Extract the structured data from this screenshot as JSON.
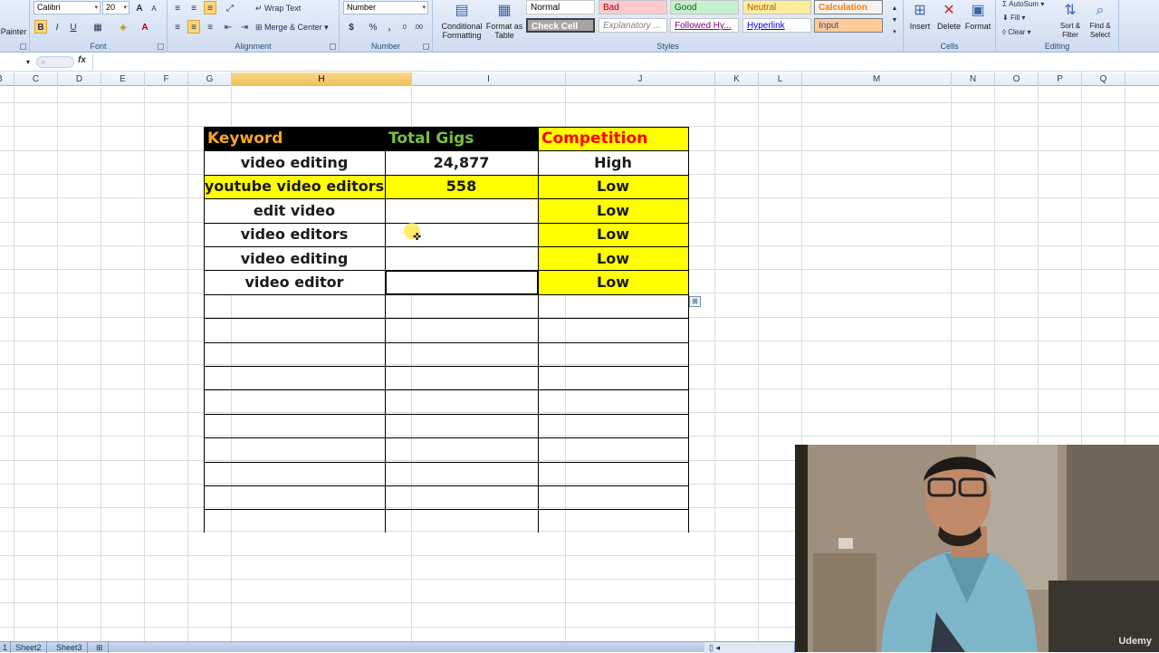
{
  "ribbon": {
    "clipboard": {
      "painter_label": "Painter"
    },
    "font": {
      "family": "Calibri",
      "size": "20",
      "bold": "B",
      "italic": "I",
      "underline": "U",
      "grow": "A",
      "shrink": "A",
      "group_label": "Font"
    },
    "alignment": {
      "wrap_text": "Wrap Text",
      "merge_center": "Merge & Center",
      "group_label": "Alignment"
    },
    "number": {
      "format": "Number",
      "currency": "$",
      "percent": "%",
      "comma": ",",
      "group_label": "Number"
    },
    "styles": {
      "conditional_formatting": "Conditional Formatting",
      "format_as_table": "Format as Table",
      "items": [
        {
          "label": "Normal",
          "bg": "#ffffff",
          "fg": "#000000"
        },
        {
          "label": "Bad",
          "bg": "#ffc7ce",
          "fg": "#9c0006"
        },
        {
          "label": "Good",
          "bg": "#c6efce",
          "fg": "#006100"
        },
        {
          "label": "Neutral",
          "bg": "#ffeb9c",
          "fg": "#9c6500"
        },
        {
          "label": "Calculation",
          "bg": "#f2f2f2",
          "fg": "#fa7d00"
        },
        {
          "label": "Check Cell",
          "bg": "#a5a5a5",
          "fg": "#ffffff"
        },
        {
          "label": "Explanatory ...",
          "bg": "#ffffff",
          "fg": "#7f7f7f"
        },
        {
          "label": "Followed Hy...",
          "bg": "#ffffff",
          "fg": "#800080"
        },
        {
          "label": "Hyperlink",
          "bg": "#ffffff",
          "fg": "#0000ff"
        },
        {
          "label": "Input",
          "bg": "#ffcc99",
          "fg": "#3f3f76"
        }
      ],
      "group_label": "Styles"
    },
    "cells": {
      "insert": "Insert",
      "delete": "Delete",
      "format": "Format",
      "group_label": "Cells"
    },
    "editing": {
      "autosum": "AutoSum",
      "fill": "Fill",
      "clear": "Clear",
      "sort_filter": "Sort & Filter",
      "find_select": "Find & Select",
      "group_label": "Editing"
    }
  },
  "formula_bar": {
    "search_placeholder": "",
    "fx": "fx",
    "value": ""
  },
  "columns": [
    {
      "label": "B"
    },
    {
      "label": "C"
    },
    {
      "label": "D"
    },
    {
      "label": "E"
    },
    {
      "label": "F"
    },
    {
      "label": "G"
    },
    {
      "label": "H",
      "selected": true
    },
    {
      "label": "I"
    },
    {
      "label": "J"
    },
    {
      "label": "K"
    },
    {
      "label": "L"
    },
    {
      "label": "M"
    },
    {
      "label": "N"
    },
    {
      "label": "O"
    },
    {
      "label": "P"
    },
    {
      "label": "Q"
    }
  ],
  "table": {
    "headers": [
      {
        "text": "Keyword",
        "color": "#f5a623",
        "bg": "#000000"
      },
      {
        "text": "Total Gigs",
        "color": "#7cbf3b",
        "bg": "#000000"
      },
      {
        "text": "Competition",
        "color": "#ff0000",
        "bg": "#ffff00"
      }
    ],
    "rows": [
      {
        "keyword": "video editing",
        "gigs": "24,877",
        "competition": "High",
        "keyword_bg": "#ffffff",
        "gigs_bg": "#ffffff",
        "comp_bg": "#ffffff"
      },
      {
        "keyword": "youtube video editors",
        "gigs": "558",
        "competition": "Low",
        "keyword_bg": "#ffff00",
        "gigs_bg": "#ffff00",
        "comp_bg": "#ffff00"
      },
      {
        "keyword": "edit video",
        "gigs": "",
        "competition": "Low",
        "keyword_bg": "#ffffff",
        "gigs_bg": "#ffffff",
        "comp_bg": "#ffff00"
      },
      {
        "keyword": "video editors",
        "gigs": "",
        "competition": "Low",
        "keyword_bg": "#ffffff",
        "gigs_bg": "#ffffff",
        "comp_bg": "#ffff00"
      },
      {
        "keyword": "video editing",
        "gigs": "",
        "competition": "Low",
        "keyword_bg": "#ffffff",
        "gigs_bg": "#ffffff",
        "comp_bg": "#ffff00"
      },
      {
        "keyword": "video editor",
        "gigs": "",
        "competition": "Low",
        "keyword_bg": "#ffffff",
        "gigs_bg": "#ffffff",
        "comp_bg": "#ffff00"
      }
    ]
  },
  "sheet_tabs": [
    {
      "label": "Sheet2"
    },
    {
      "label": "Sheet3"
    }
  ],
  "webcam": {
    "watermark": "Udemy"
  }
}
